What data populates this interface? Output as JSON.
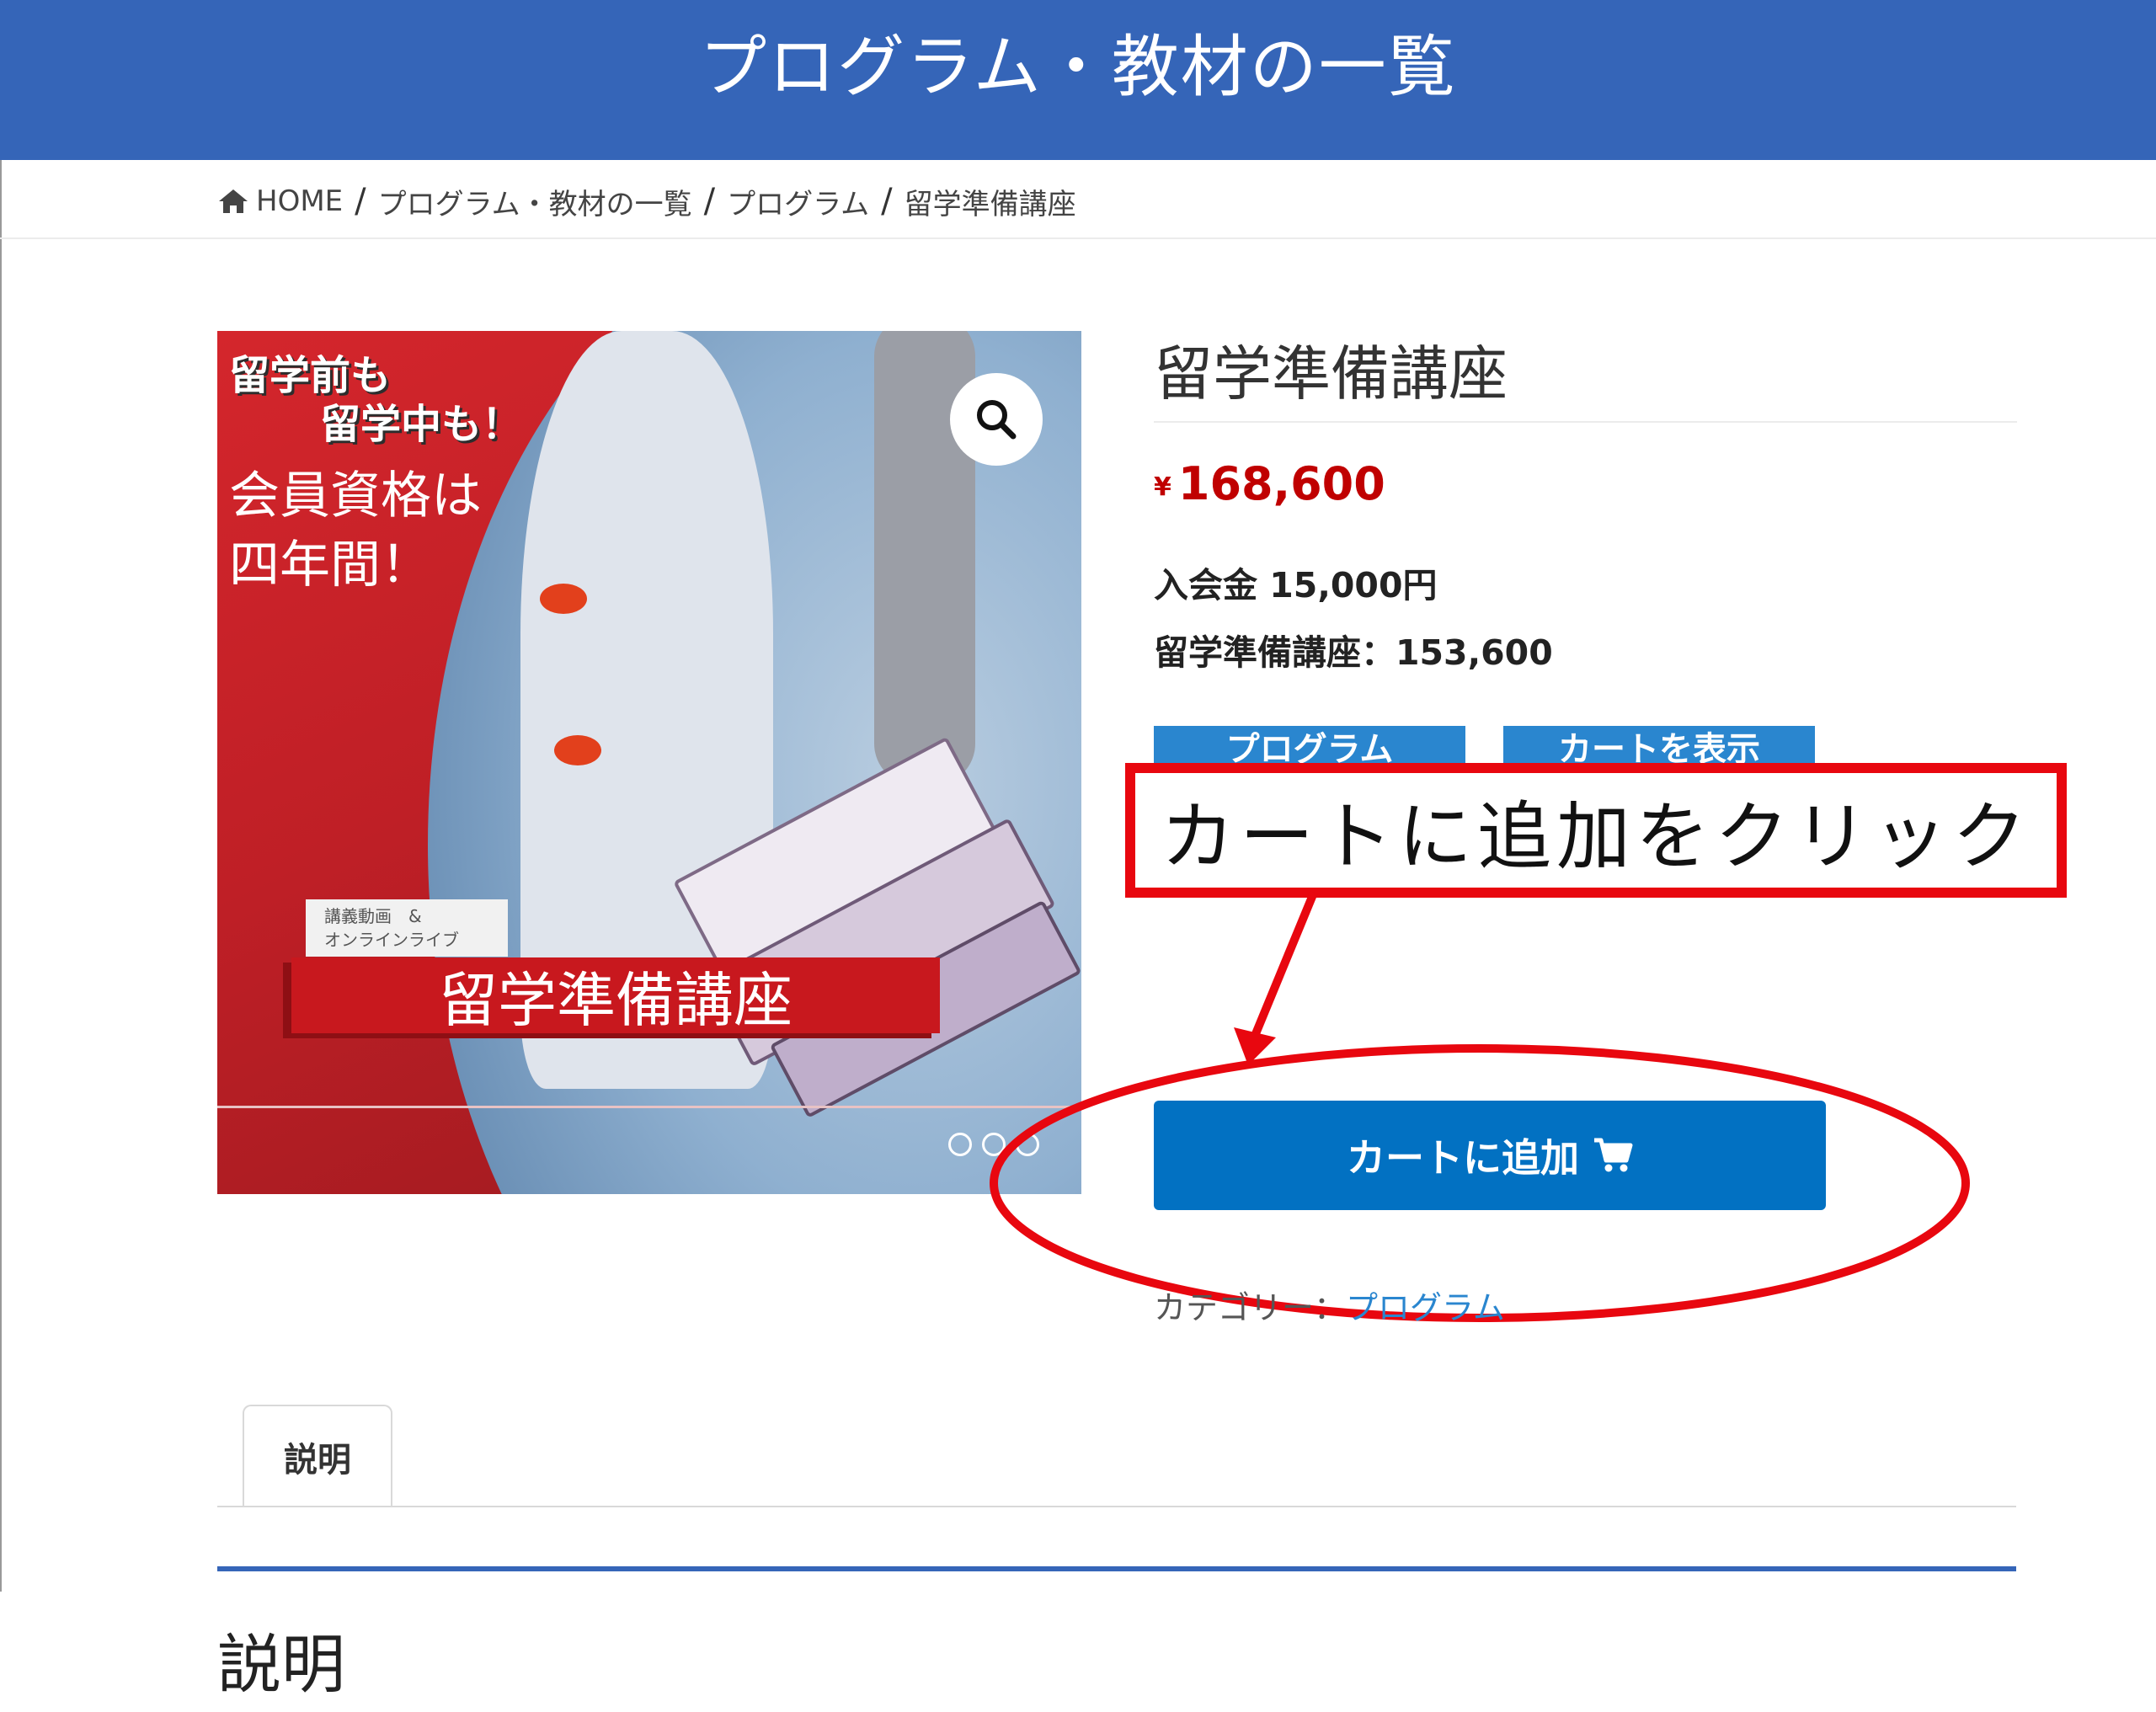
{
  "header": {
    "title": "プログラム・教材の一覧"
  },
  "breadcrumb": {
    "home": "HOME",
    "separator": "/",
    "items": [
      "プログラム・教材の一覧",
      "プログラム",
      "留学準備講座"
    ]
  },
  "product_image": {
    "catch_line1": "留学前も",
    "catch_line2": "留学中も！",
    "main_line1": "会員資格は",
    "main_line2": "四年間！",
    "sub_label": "講義動画　&\nオンラインライブ",
    "title_banner": "留学準備講座",
    "zoom_icon": "magnifier-icon",
    "social_icons": [
      "instagram-icon",
      "facebook-icon",
      "twitter-icon"
    ]
  },
  "product": {
    "title": "留学準備講座",
    "currency": "¥",
    "price": "168,600",
    "detail_line1": "入会金 15,000円",
    "detail_line2": "留学準備講座：153,600",
    "category_chip": "プログラム",
    "view_chip": "カートを表示",
    "add_to_cart": "カートに追加",
    "category_label": "カテゴリー：",
    "category_value": "プログラム"
  },
  "annotation": {
    "callout_text": "カートに追加をクリック"
  },
  "tabs": [
    {
      "label": "説明",
      "active": true
    }
  ],
  "section": {
    "heading": "説明"
  },
  "colors": {
    "header_bg": "#3565b8",
    "price": "#c00000",
    "button": "#0271c2",
    "annotation_red": "#e8070f"
  }
}
